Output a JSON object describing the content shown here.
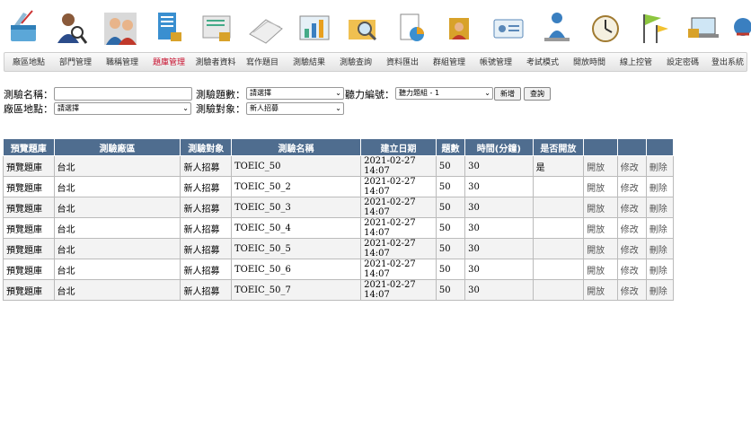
{
  "menu": [
    {
      "label": "廠區地點",
      "icon": "basket-icon"
    },
    {
      "label": "部門管理",
      "icon": "magnifier-person-icon"
    },
    {
      "label": "職稱管理",
      "icon": "people-icon"
    },
    {
      "label": "題庫管理",
      "icon": "document-lock-icon",
      "active": true
    },
    {
      "label": "測驗者資料",
      "icon": "form-lock-icon"
    },
    {
      "label": "寫作題目",
      "icon": "papers-icon"
    },
    {
      "label": "測驗結果",
      "icon": "chart-icon"
    },
    {
      "label": "測驗查詢",
      "icon": "folder-search-icon"
    },
    {
      "label": "資料匯出",
      "icon": "export-chart-icon"
    },
    {
      "label": "群組管理",
      "icon": "group-lock-icon"
    },
    {
      "label": "帳號管理",
      "icon": "id-card-icon"
    },
    {
      "label": "考試模式",
      "icon": "exam-person-icon"
    },
    {
      "label": "開放時間",
      "icon": "clock-icon"
    },
    {
      "label": "線上控管",
      "icon": "flags-icon"
    },
    {
      "label": "設定密碼",
      "icon": "laptop-lock-icon"
    },
    {
      "label": "登出系統",
      "icon": "logout-globe-icon"
    }
  ],
  "form": {
    "test_name_label": "測驗名稱：",
    "test_name_value": "",
    "question_count_label": "測驗題數：",
    "question_count_value": "請選擇",
    "listening_label": "聽力編號：",
    "listening_value": "聽力題組 - 1",
    "add_button": "新增",
    "query_button": "查詢",
    "site_label": "廠區地點：",
    "site_value": "請選擇",
    "target_label": "測驗對象：",
    "target_value": "新人招募"
  },
  "table": {
    "headers": [
      "預覽題庫",
      "測驗廠區",
      "測驗對象",
      "測驗名稱",
      "建立日期",
      "題數",
      "時間(分鐘)",
      "是否開放",
      "",
      "",
      ""
    ],
    "rows": [
      [
        "預覽題庫",
        "台北",
        "新人招募",
        "TOEIC_50",
        "2021-02-27 14:07",
        "50",
        "30",
        "是",
        "開放",
        "修改",
        "刪除"
      ],
      [
        "預覽題庫",
        "台北",
        "新人招募",
        "TOEIC_50_2",
        "2021-02-27 14:07",
        "50",
        "30",
        "",
        "開放",
        "修改",
        "刪除"
      ],
      [
        "預覽題庫",
        "台北",
        "新人招募",
        "TOEIC_50_3",
        "2021-02-27 14:07",
        "50",
        "30",
        "",
        "開放",
        "修改",
        "刪除"
      ],
      [
        "預覽題庫",
        "台北",
        "新人招募",
        "TOEIC_50_4",
        "2021-02-27 14:07",
        "50",
        "30",
        "",
        "開放",
        "修改",
        "刪除"
      ],
      [
        "預覽題庫",
        "台北",
        "新人招募",
        "TOEIC_50_5",
        "2021-02-27 14:07",
        "50",
        "30",
        "",
        "開放",
        "修改",
        "刪除"
      ],
      [
        "預覽題庫",
        "台北",
        "新人招募",
        "TOEIC_50_6",
        "2021-02-27 14:07",
        "50",
        "30",
        "",
        "開放",
        "修改",
        "刪除"
      ],
      [
        "預覽題庫",
        "台北",
        "新人招募",
        "TOEIC_50_7",
        "2021-02-27 14:07",
        "50",
        "30",
        "",
        "開放",
        "修改",
        "刪除"
      ]
    ]
  },
  "colors": {
    "header_bg": "#4f6d8f",
    "active_menu": "#c8102e"
  }
}
